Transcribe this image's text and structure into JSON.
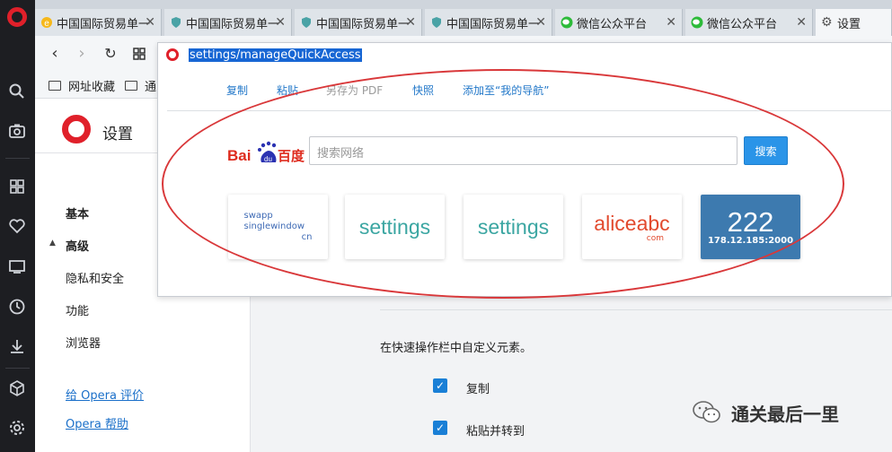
{
  "tabs": [
    {
      "label": "中国国际贸易单一",
      "icon": "e-icon"
    },
    {
      "label": "中国国际贸易单一",
      "icon": "shield-icon"
    },
    {
      "label": "中国国际贸易单一",
      "icon": "shield-icon"
    },
    {
      "label": "中国国际贸易单一",
      "icon": "shield-icon"
    },
    {
      "label": "微信公众平台",
      "icon": "wechat-icon"
    },
    {
      "label": "微信公众平台",
      "icon": "wechat-icon"
    },
    {
      "label": "设置",
      "icon": "gear-icon"
    }
  ],
  "bookmarks": [
    {
      "label": "网址收藏"
    },
    {
      "label": "通"
    }
  ],
  "settings": {
    "title": "设置",
    "nav": {
      "basic": "基本",
      "advanced": "高级",
      "privacy": "隐私和安全",
      "features": "功能",
      "browser": "浏览器",
      "rate": "给 Opera 评价",
      "help": "Opera 帮助"
    },
    "customize_text": "在快速操作栏中自定义元素。",
    "option_copy": "复制",
    "option_paste_go": "粘贴并转到"
  },
  "popup": {
    "url": "settings/manageQuickAccess",
    "menu": {
      "copy": "复制",
      "paste": "粘贴",
      "save_pdf": "另存为 PDF",
      "snapshot": "快照",
      "add_nav": "添加至“我的导航”"
    },
    "baidu_logo": "百度",
    "search_placeholder": "搜索网络",
    "search_button": "搜索",
    "tiles": [
      {
        "lines": [
          "swapp",
          "singlewindow",
          "cn"
        ]
      },
      {
        "text": "settings"
      },
      {
        "text": "settings"
      },
      {
        "text": "aliceabc",
        "sub": "com"
      },
      {
        "text": "222",
        "sub": "178.12.185:2000"
      }
    ]
  },
  "watermark": "通关最后一里",
  "colors": {
    "opera_red": "#e0202a",
    "link_blue": "#2378c9",
    "highlight_blue": "#1766d4",
    "annotation_red": "#d9383a",
    "tile_blue": "#3d7aaf"
  }
}
